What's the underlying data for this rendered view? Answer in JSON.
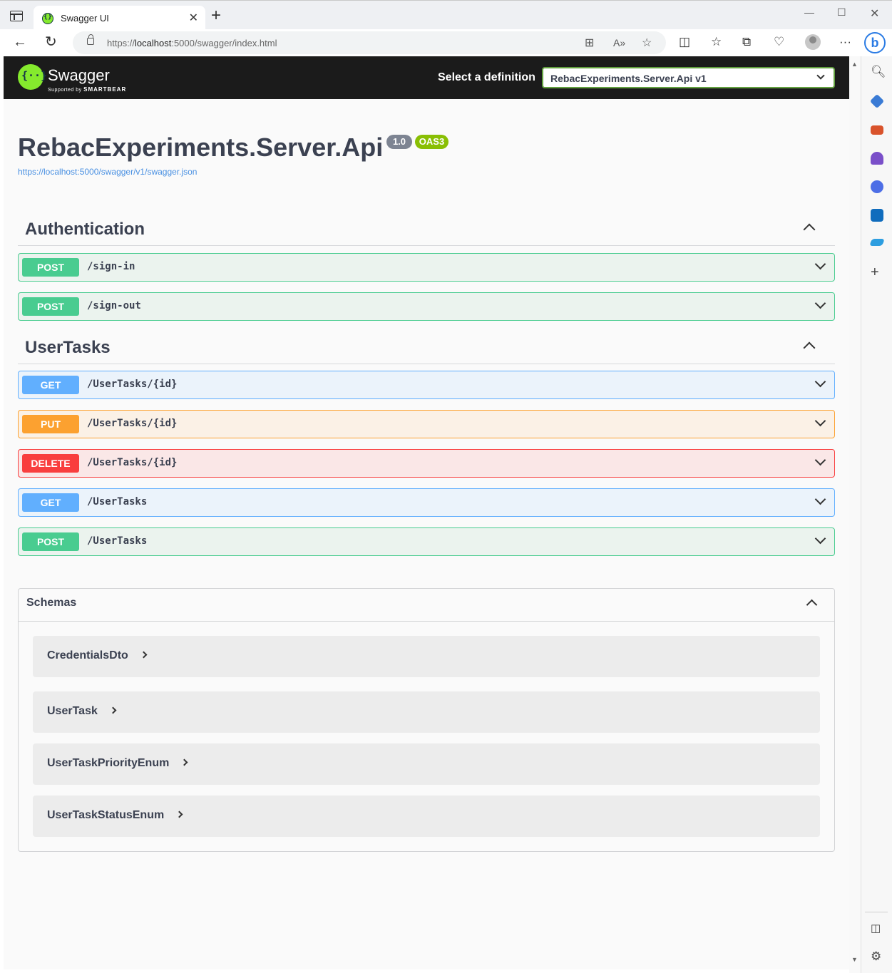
{
  "browser": {
    "tab_title": "Swagger UI",
    "url_prefix": "https://",
    "url_host": "localhost",
    "url_rest": ":5000/swagger/index.html"
  },
  "topbar": {
    "logo_text": "Swagger",
    "logo_sub_prefix": "Supported by",
    "logo_sub_brand": "SMARTBEAR",
    "definition_label": "Select a definition",
    "definition_value": "RebacExperiments.Server.Api v1"
  },
  "info": {
    "title": "RebacExperiments.Server.Api",
    "version": "1.0",
    "oas": "OAS3",
    "spec_url": "https://localhost:5000/swagger/v1/swagger.json"
  },
  "sections": [
    {
      "name": "Authentication",
      "operations": [
        {
          "method": "POST",
          "path": "/sign-in"
        },
        {
          "method": "POST",
          "path": "/sign-out"
        }
      ]
    },
    {
      "name": "UserTasks",
      "operations": [
        {
          "method": "GET",
          "path": "/UserTasks/{id}"
        },
        {
          "method": "PUT",
          "path": "/UserTasks/{id}"
        },
        {
          "method": "DELETE",
          "path": "/UserTasks/{id}"
        },
        {
          "method": "GET",
          "path": "/UserTasks"
        },
        {
          "method": "POST",
          "path": "/UserTasks"
        }
      ]
    }
  ],
  "schemas": {
    "title": "Schemas",
    "models": [
      "CredentialsDto",
      "UserTask",
      "UserTaskPriorityEnum",
      "UserTaskStatusEnum"
    ]
  },
  "colors": {
    "post": "#49cc90",
    "get": "#61affe",
    "put": "#fca130",
    "delete": "#f93e3e",
    "swagger_green": "#85ea2d"
  }
}
